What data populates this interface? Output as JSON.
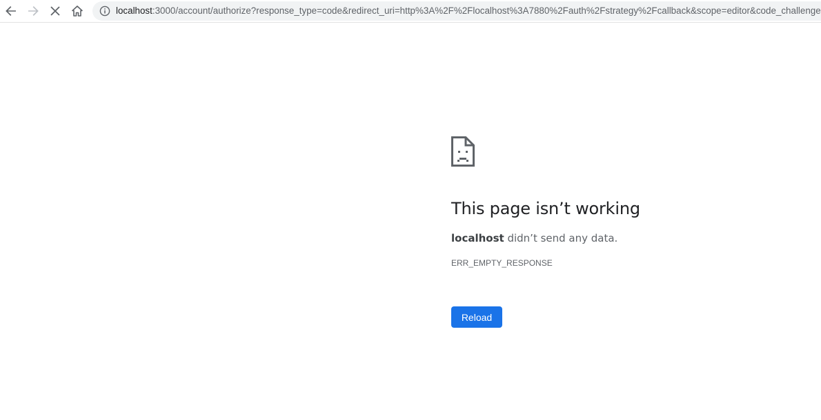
{
  "browser": {
    "icons": {
      "back": "arrow-left-icon",
      "forward": "arrow-right-icon",
      "stop": "close-icon",
      "home": "home-icon",
      "site_info": "info-icon"
    },
    "url_host": "localhost",
    "url_rest": ":3000/account/authorize?response_type=code&redirect_uri=http%3A%2F%2Flocalhost%3A7880%2Fauth%2Fstrategy%2Fcallback&scope=editor&code_challenge=",
    "forward_enabled": false
  },
  "error_page": {
    "icon": "sad-page-icon",
    "title": "This page isn’t working",
    "host": "localhost",
    "message": " didn’t send any data.",
    "error_code": "ERR_EMPTY_RESPONSE",
    "reload_label": "Reload"
  },
  "colors": {
    "accent": "#1a73e8",
    "title_text": "#202124",
    "body_text": "#5f6368",
    "omnibox_bg": "#f1f3f4"
  }
}
